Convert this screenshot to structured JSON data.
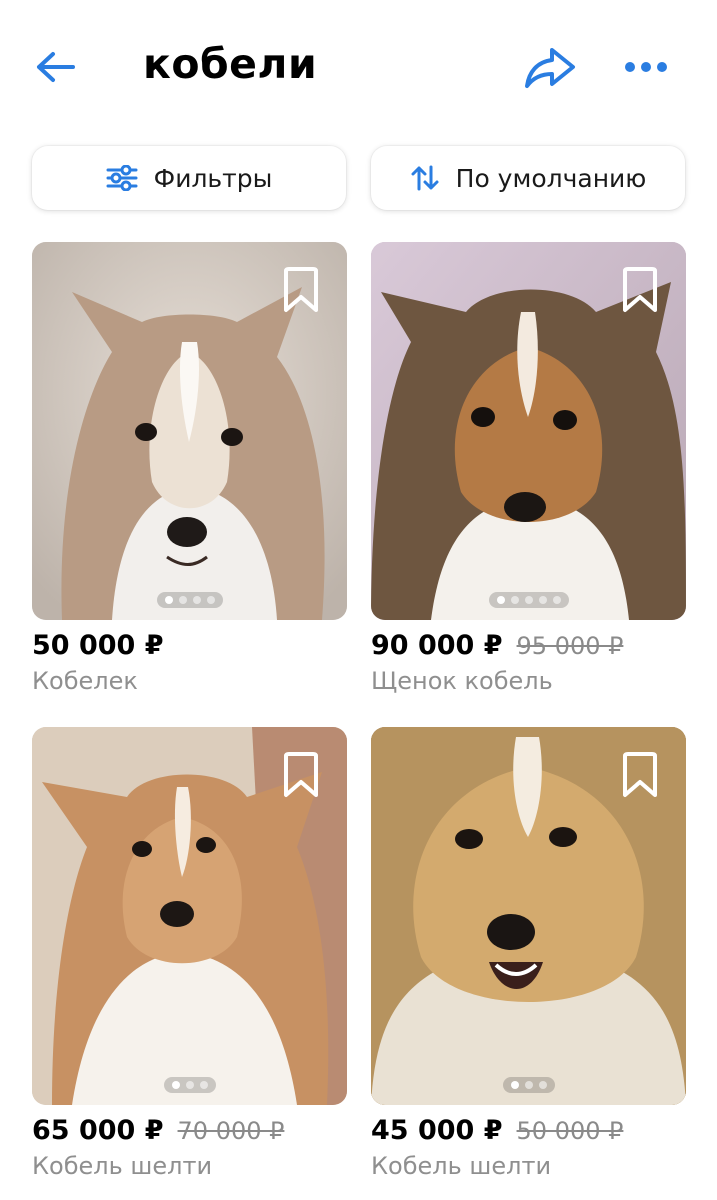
{
  "header": {
    "title": "кобели",
    "accent": "#2a7de1"
  },
  "toolbar": {
    "filters_label": "Фильтры",
    "sort_label": "По умолчанию"
  },
  "listings": [
    {
      "price": "50 000 ₽",
      "old_price": "",
      "name": "Кобелек",
      "photos": 4,
      "active_photo": 0
    },
    {
      "price": "90 000 ₽",
      "old_price": "95 000 ₽",
      "name": "Щенок кобель",
      "photos": 5,
      "active_photo": 0
    },
    {
      "price": "65 000 ₽",
      "old_price": "70 000 ₽",
      "name": "Кобель шелти",
      "photos": 3,
      "active_photo": 0
    },
    {
      "price": "45 000 ₽",
      "old_price": "50 000 ₽",
      "name": "Кобель шелти",
      "photos": 3,
      "active_photo": 0
    }
  ]
}
